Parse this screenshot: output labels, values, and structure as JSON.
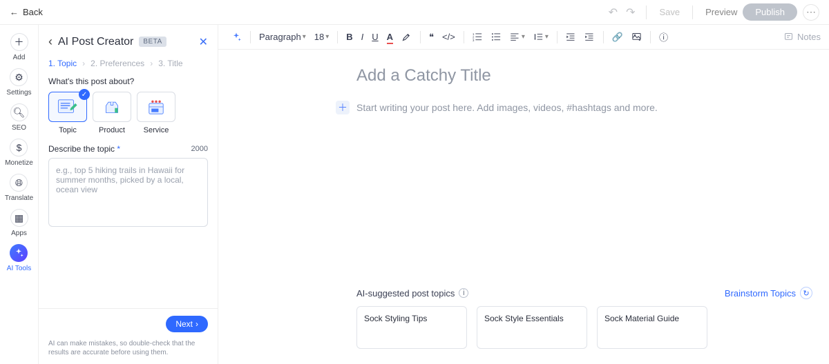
{
  "topbar": {
    "back_label": "Back",
    "save_label": "Save",
    "preview_label": "Preview",
    "publish_label": "Publish"
  },
  "rail": {
    "items": [
      {
        "label": "Add"
      },
      {
        "label": "Settings"
      },
      {
        "label": "SEO"
      },
      {
        "label": "Monetize"
      },
      {
        "label": "Translate"
      },
      {
        "label": "Apps"
      },
      {
        "label": "AI Tools"
      }
    ]
  },
  "panel": {
    "title": "AI Post Creator",
    "beta_label": "BETA",
    "steps": [
      {
        "label": "1.  Topic",
        "active": true
      },
      {
        "label": "2.  Preferences",
        "active": false
      },
      {
        "label": "3.  Title",
        "active": false
      }
    ],
    "question_label": "What's this post about?",
    "cards": [
      {
        "label": "Topic",
        "selected": true
      },
      {
        "label": "Product",
        "selected": false
      },
      {
        "label": "Service",
        "selected": false
      }
    ],
    "describe_label": "Describe the topic",
    "char_limit": "2000",
    "describe_placeholder": "e.g., top 5 hiking trails in Hawaii for summer months, picked by a local, ocean view",
    "next_label": "Next",
    "disclaimer": "AI can make mistakes, so double-check that the results are accurate before using them."
  },
  "toolbar": {
    "paragraph_label": "Paragraph",
    "font_size": "18",
    "notes_label": "Notes"
  },
  "editor": {
    "title_placeholder": "Add a Catchy Title",
    "body_placeholder": "Start writing your post here. Add images, videos, #hashtags and more."
  },
  "suggestions": {
    "title": "AI-suggested post topics",
    "brainstorm_label": "Brainstorm Topics",
    "cards": [
      "Sock Styling Tips",
      "Sock Style Essentials",
      "Sock Material Guide"
    ]
  }
}
